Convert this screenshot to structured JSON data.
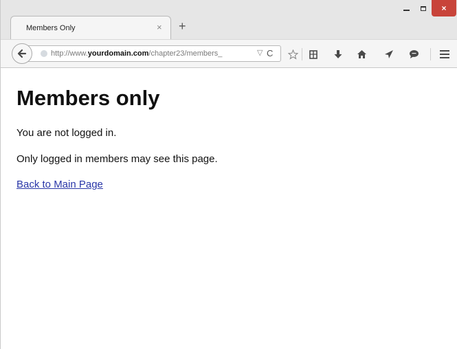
{
  "window": {
    "close_glyph": "×"
  },
  "tab": {
    "title": "Members Only",
    "close_glyph": "×",
    "new_tab_glyph": "+"
  },
  "navbar": {
    "url_prefix": "http://www.",
    "url_domain": "yourdomain.com",
    "url_path": "/chapter23/members_",
    "dropmarker_glyph": "▽",
    "reload_glyph": "C",
    "icons": [
      "back-icon",
      "star-icon",
      "reading-list-icon",
      "download-icon",
      "home-icon",
      "send-icon",
      "chat-icon",
      "menu-icon"
    ]
  },
  "page": {
    "heading": "Members only",
    "paragraph_1": "You are not logged in.",
    "paragraph_2": "Only logged in members may see this page.",
    "link_text": "Back to Main Page"
  },
  "colors": {
    "link": "#2a37a8",
    "close_button": "#c8443a",
    "chrome": "#e6e6e6"
  }
}
